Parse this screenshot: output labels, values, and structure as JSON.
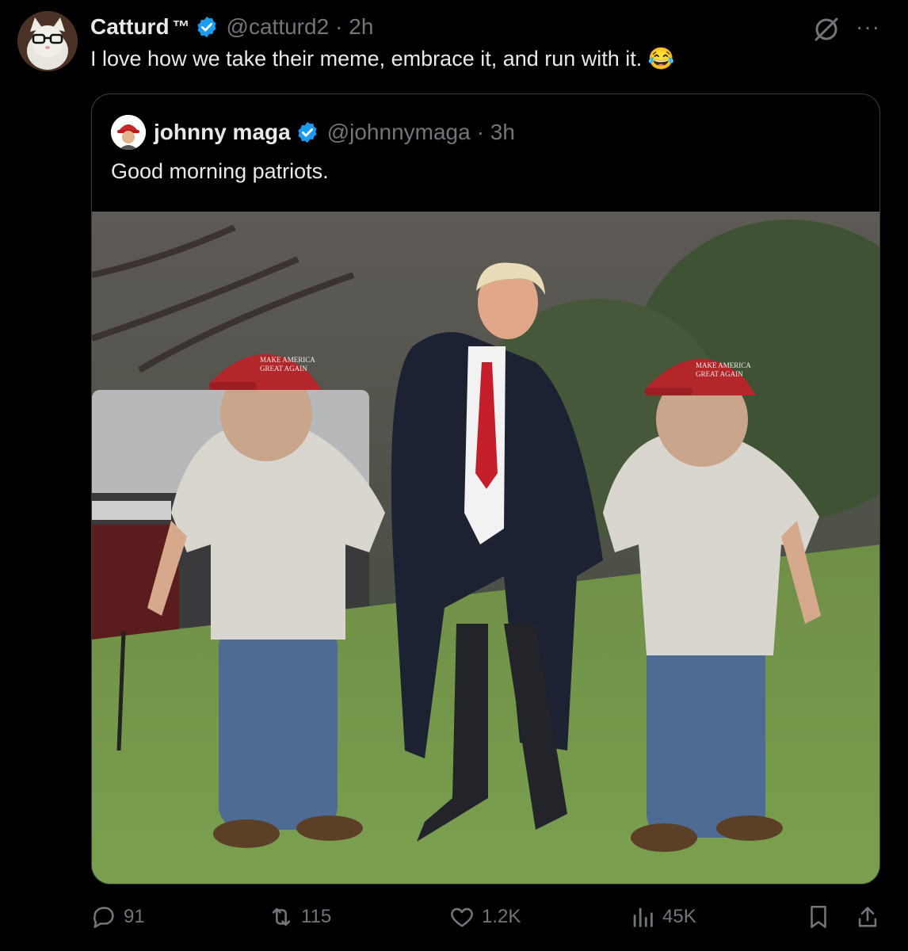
{
  "tweet": {
    "author_name": "Catturd",
    "author_mark": "™",
    "handle": "@catturd2",
    "time": "· 2h",
    "text": "I love how we take their meme, embrace it, and run with it. 😂",
    "more_label": "···"
  },
  "quote": {
    "author_name": "johnny maga",
    "handle": "@johnnymaga",
    "time": "· 3h",
    "text": "Good morning patriots.",
    "cap_text_line1": "MAKE AMERICA",
    "cap_text_line2": "GREAT AGAIN"
  },
  "actions": {
    "replies": "91",
    "reposts": "115",
    "likes": "1.2K",
    "views": "45K"
  },
  "colors": {
    "background": "#000000",
    "text": "#e7e9ea",
    "muted": "#71767b",
    "verified": "#1d9bf0",
    "border": "#3a3d41"
  }
}
